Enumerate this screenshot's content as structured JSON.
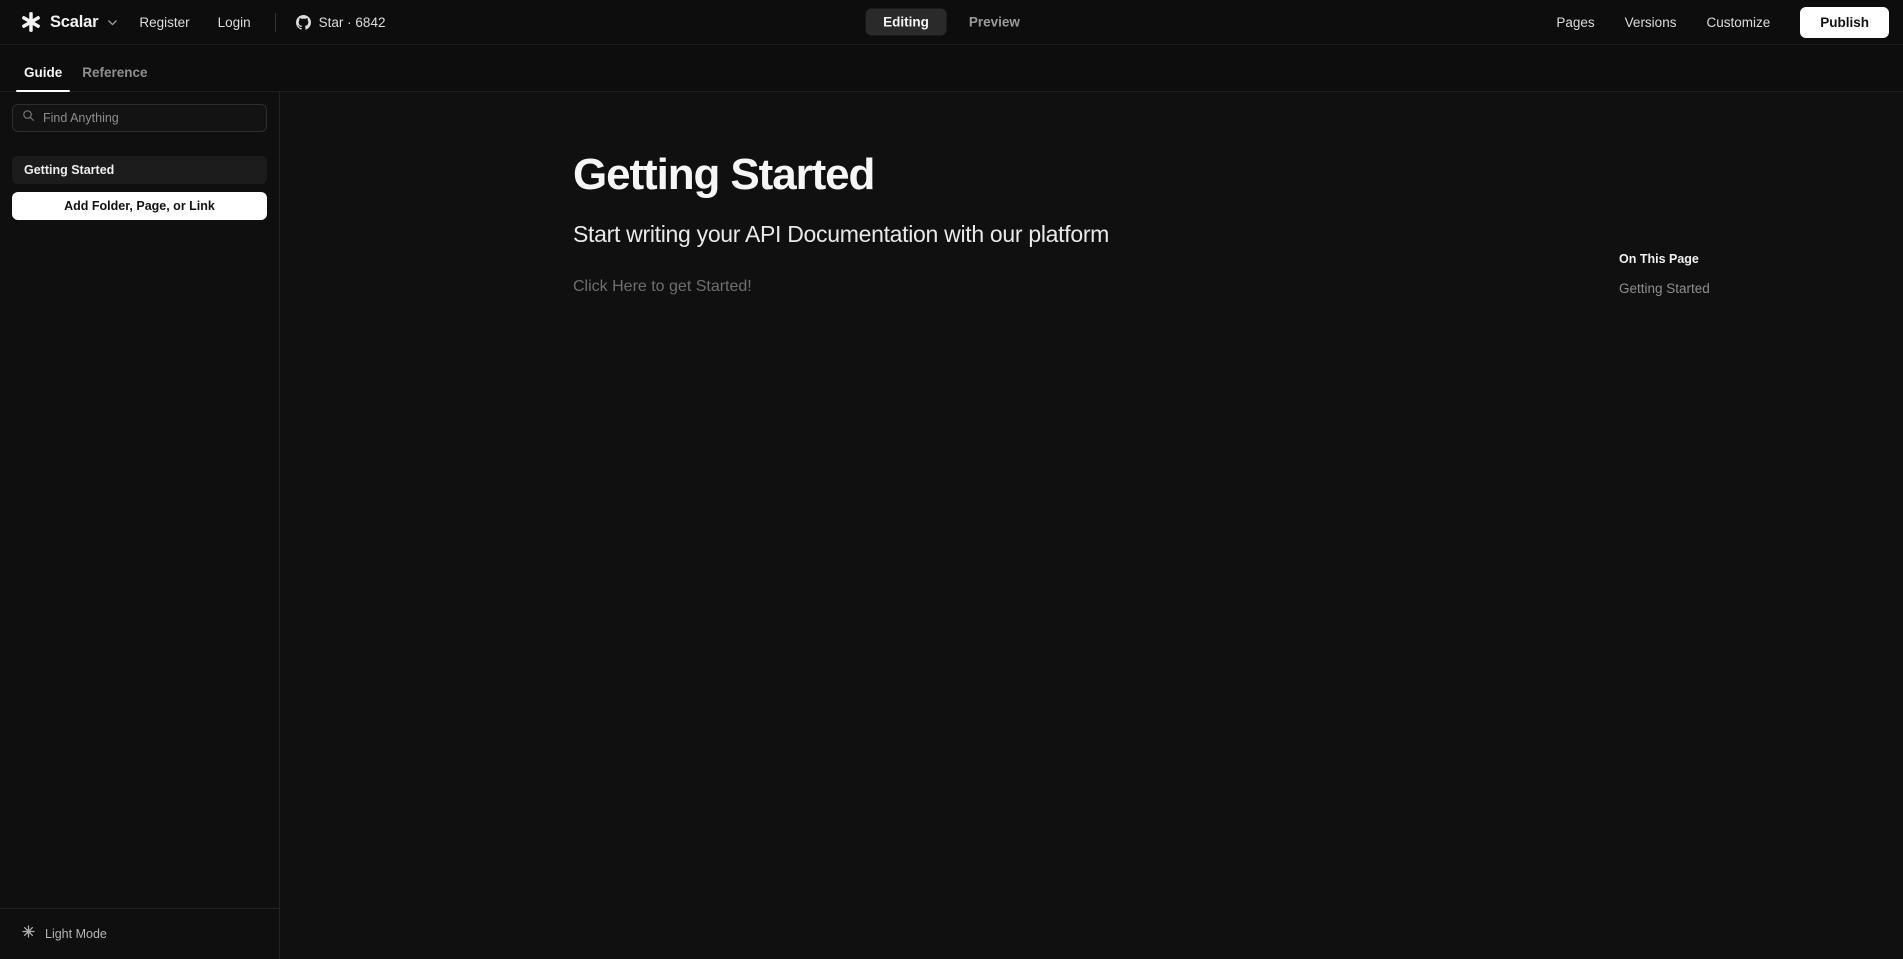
{
  "topbar": {
    "brand_name": "Scalar",
    "brand_icon": "scalar-logo-icon",
    "chevron_icon": "chevron-down-icon",
    "links": [
      {
        "label": "Register",
        "name": "register-link"
      },
      {
        "label": "Login",
        "name": "login-link"
      }
    ],
    "github": {
      "icon": "github-icon",
      "label": "Star · 6842",
      "star_count": "6842"
    },
    "modes": [
      {
        "label": "Editing",
        "active": true
      },
      {
        "label": "Preview",
        "active": false
      }
    ],
    "right_links": [
      {
        "label": "Pages",
        "name": "pages-link"
      },
      {
        "label": "Versions",
        "name": "versions-link"
      },
      {
        "label": "Customize",
        "name": "customize-link"
      }
    ],
    "publish_label": "Publish"
  },
  "doctabs": [
    {
      "label": "Guide",
      "active": true
    },
    {
      "label": "Reference",
      "active": false
    }
  ],
  "sidebar": {
    "search": {
      "placeholder": "Find Anything",
      "icon": "search-icon"
    },
    "items": [
      {
        "label": "Getting Started",
        "active": true
      }
    ],
    "add_button_label": "Add Folder, Page, or Link",
    "theme_toggle": {
      "label": "Light Mode",
      "icon": "sun-icon"
    }
  },
  "main": {
    "title": "Getting Started",
    "subtitle": "Start writing your API Documentation with our platform",
    "body_placeholder": "Click Here to get Started!"
  },
  "on_this_page": {
    "title": "On This Page",
    "links": [
      {
        "label": "Getting Started"
      }
    ]
  },
  "colors": {
    "background": "#0d0d0d",
    "sidebar_bg": "#0f0f0f",
    "main_bg": "#101010",
    "accent_white": "#ffffff",
    "border": "#232323",
    "active_pill": "#2a2a2a",
    "muted_text": "#8d8d8d"
  }
}
